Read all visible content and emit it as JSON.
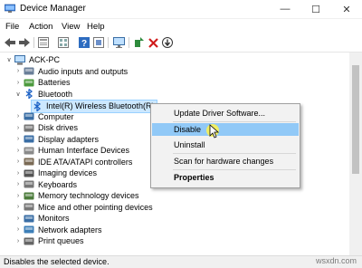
{
  "window": {
    "title": "Device Manager",
    "minimize_icon": "minimize-icon",
    "maximize_icon": "maximize-icon",
    "close_icon": "close-icon"
  },
  "menu": [
    "File",
    "Action",
    "View",
    "Help"
  ],
  "toolbar_icons": [
    "back-arrow-icon",
    "forward-arrow-icon",
    "properties-icon",
    "update-icon",
    "help-icon",
    "scan-icon",
    "monitor-icon",
    "enable-icon",
    "uninstall-x-icon",
    "disable-down-icon"
  ],
  "tree": {
    "root": "ACK-PC",
    "items": [
      {
        "label": "Audio inputs and outputs",
        "icon": "speaker-icon"
      },
      {
        "label": "Batteries",
        "icon": "battery-icon"
      },
      {
        "label": "Bluetooth",
        "icon": "bluetooth-icon",
        "expanded": true
      },
      {
        "label": "Intel(R) Wireless Bluetooth(R)",
        "icon": "bluetooth-icon",
        "child": true,
        "selected": true
      },
      {
        "label": "Computer",
        "icon": "computer-icon"
      },
      {
        "label": "Disk drives",
        "icon": "disk-icon"
      },
      {
        "label": "Display adapters",
        "icon": "display-icon"
      },
      {
        "label": "Human Interface Devices",
        "icon": "hid-icon"
      },
      {
        "label": "IDE ATA/ATAPI controllers",
        "icon": "ide-icon"
      },
      {
        "label": "Imaging devices",
        "icon": "camera-icon"
      },
      {
        "label": "Keyboards",
        "icon": "keyboard-icon"
      },
      {
        "label": "Memory technology devices",
        "icon": "memory-icon"
      },
      {
        "label": "Mice and other pointing devices",
        "icon": "mouse-icon"
      },
      {
        "label": "Monitors",
        "icon": "monitor-icon"
      },
      {
        "label": "Network adapters",
        "icon": "network-icon"
      },
      {
        "label": "Print queues",
        "icon": "printer-icon"
      }
    ]
  },
  "context_menu": {
    "items": [
      "Update Driver Software...",
      "Disable",
      "Uninstall",
      "Scan for hardware changes",
      "Properties"
    ],
    "highlighted": "Disable"
  },
  "status": "Disables the selected device.",
  "watermark": "wsxdn.com"
}
